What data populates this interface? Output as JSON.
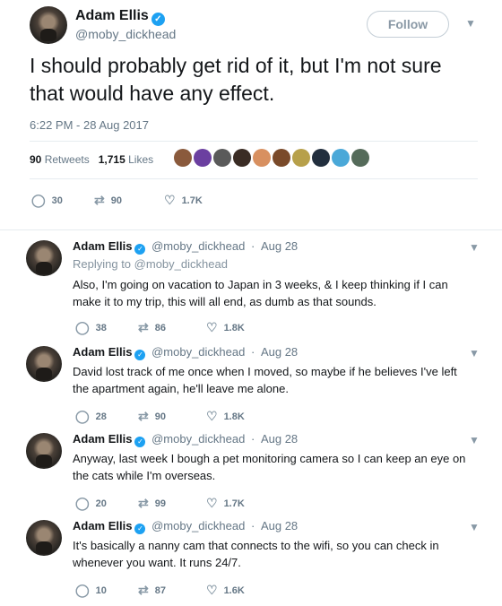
{
  "tweet": {
    "author_name": "Adam Ellis",
    "author_handle": "@moby_dickhead",
    "follow_label": "Follow",
    "text": "I should probably get rid of it, but I'm not sure that would have any effect.",
    "timestamp": "6:22 PM - 28 Aug 2017",
    "retweets_count": "90",
    "retweets_label": "Retweets",
    "likes_count": "1,715",
    "likes_label": "Likes",
    "reply_count": "30",
    "retweet_count": "90",
    "like_count": "1.7K",
    "liker_colors": [
      "#8a5a3c",
      "#6b3fa0",
      "#5a5a5a",
      "#3a2c24",
      "#d89060",
      "#7a4a2a",
      "#b7a04a",
      "#222f3e",
      "#4aa8d8",
      "#556b5a"
    ]
  },
  "replies": [
    {
      "author_name": "Adam Ellis",
      "author_handle": "@moby_dickhead",
      "date": "Aug 28",
      "replying_prefix": "Replying to",
      "replying_to": "@moby_dickhead",
      "text": "Also, I'm going on vacation to Japan in 3 weeks, & I keep thinking if I can make it to my trip, this will all end, as dumb as that sounds.",
      "reply_count": "38",
      "retweet_count": "86",
      "like_count": "1.8K"
    },
    {
      "author_name": "Adam Ellis",
      "author_handle": "@moby_dickhead",
      "date": "Aug 28",
      "text": "David lost track of me once when I moved, so maybe if he believes I've left the apartment again, he'll leave me alone.",
      "reply_count": "28",
      "retweet_count": "90",
      "like_count": "1.8K"
    },
    {
      "author_name": "Adam Ellis",
      "author_handle": "@moby_dickhead",
      "date": "Aug 28",
      "text": "Anyway, last week I bough a pet monitoring camera so I can keep an eye on the cats while I'm overseas.",
      "reply_count": "20",
      "retweet_count": "99",
      "like_count": "1.7K"
    },
    {
      "author_name": "Adam Ellis",
      "author_handle": "@moby_dickhead",
      "date": "Aug 28",
      "text": "It's basically a nanny cam that connects to the wifi, so you can check in whenever you want. It runs 24/7.",
      "reply_count": "10",
      "retweet_count": "87",
      "like_count": "1.6K"
    }
  ]
}
